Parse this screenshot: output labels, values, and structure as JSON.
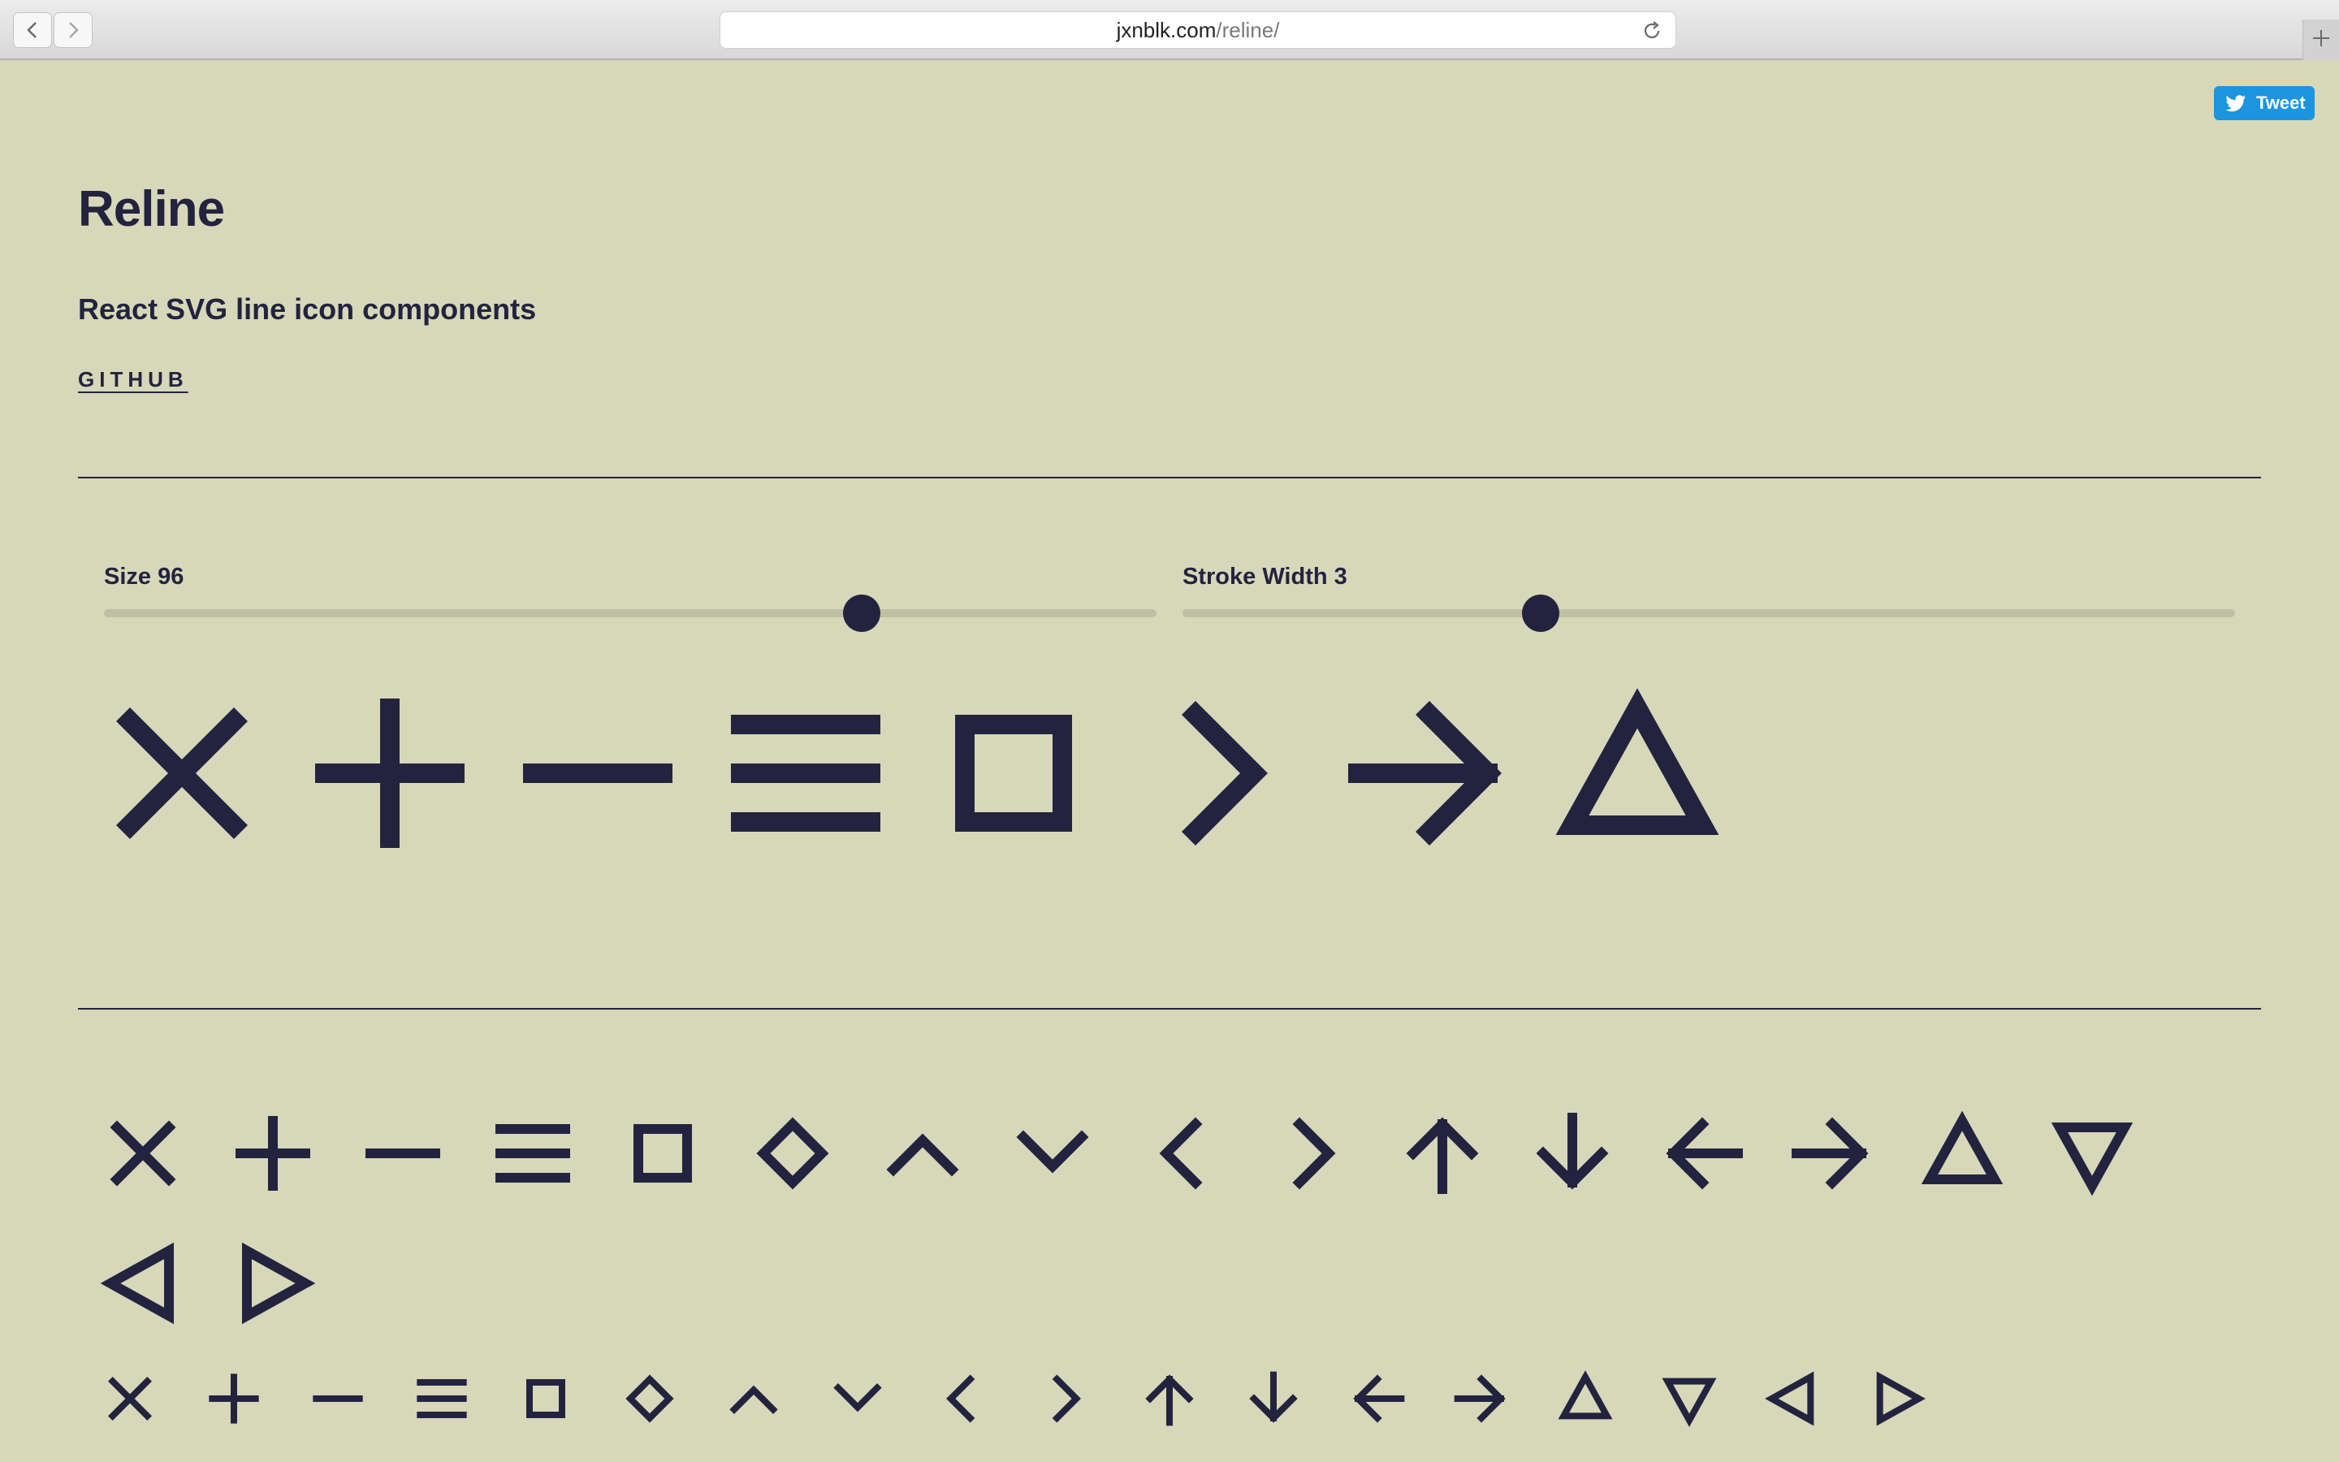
{
  "browser": {
    "url_domain": "jxnblk.com",
    "url_path": "/reline/"
  },
  "tweet": {
    "label": "Tweet"
  },
  "header": {
    "title": "Reline",
    "subtitle": "React SVG line icon components",
    "github_link": "GITHUB"
  },
  "controls": {
    "size": {
      "label": "Size 96",
      "value": 96,
      "position_fraction": 0.72
    },
    "stroke_width": {
      "label": "Stroke Width 3",
      "value": 3,
      "position_fraction": 0.34
    }
  },
  "preview_icons": [
    "close",
    "plus",
    "minus",
    "menu",
    "square",
    "chevron-right",
    "arrow-right",
    "triangle-up"
  ],
  "icon_rows": [
    [
      "close",
      "plus",
      "minus",
      "menu",
      "square",
      "diamond",
      "chevron-up",
      "chevron-down",
      "chevron-left",
      "chevron-right",
      "arrow-up",
      "arrow-down",
      "arrow-left",
      "arrow-right",
      "triangle-up",
      "triangle-down"
    ],
    [
      "triangle-left",
      "triangle-right"
    ],
    [
      "close",
      "plus",
      "minus",
      "menu",
      "square",
      "diamond",
      "chevron-up",
      "chevron-down",
      "chevron-left",
      "chevron-right",
      "arrow-up",
      "arrow-down",
      "arrow-left",
      "arrow-right",
      "triangle-up",
      "triangle-down",
      "triangle-left",
      "triangle-right"
    ]
  ],
  "colors": {
    "background": "#d6d8b9",
    "ink": "#23233f",
    "tweet": "#1b95e0",
    "track": "#bfc0a3"
  }
}
